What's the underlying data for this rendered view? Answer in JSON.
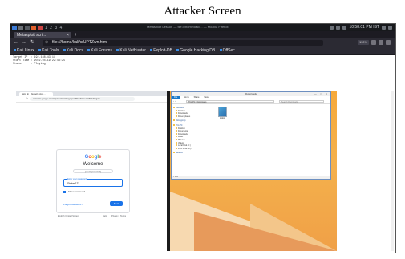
{
  "caption": "Attacker Screen",
  "kali_panel": {
    "workspaces": "1 2 3 4",
    "window_title": "Metasploit Lesson — file:///home/kali/... — Mozilla Firefox",
    "clock": "10:58:01 PM IST"
  },
  "firefox": {
    "tab_title": "Metasploit scri...",
    "tab_close": "×",
    "new_tab": "+",
    "url_scheme": "⊙",
    "url": "file:///home/kali/crUPTZwn.html",
    "zoom": "110%",
    "bookmarks": [
      "Kali Linux",
      "Kali Tools",
      "Kali Docs",
      "Kali Forums",
      "Kali NetHunter",
      "Exploit-DB",
      "Google Hacking DB",
      "OffSec"
    ]
  },
  "page": {
    "meta_text": "Target IP  : 192.168.43.11\nStart Time : 2022-04-19 22:46:25\nStatus     : Playing"
  },
  "chrome": {
    "tab_title": "Sign in - Google Acc...",
    "url": "accounts.google.com/signin/v2/challenge/pwd?flowName=GlifWebSignIn",
    "google_logo": [
      "G",
      "o",
      "o",
      "g",
      "l",
      "e"
    ],
    "title": "Welcome",
    "account": "[email protected]",
    "password_label": "Enter your password",
    "password_value": "Strikes123",
    "show_password": "Show password",
    "forgot": "Forgot password?",
    "next": "Next",
    "footer_lang": "English (United States)",
    "footer_help": "Help",
    "footer_privacy": "Privacy",
    "footer_terms": "Terms"
  },
  "explorer": {
    "title": "Downloads",
    "controls": "— □ ×",
    "ribbon": [
      "File",
      "Home",
      "Share",
      "View"
    ],
    "address": "This PC › Downloads",
    "search_placeholder": "Search Downloads",
    "nav_arrows": "‹ ›",
    "sidebar": [
      {
        "label": "Favorites",
        "group": true
      },
      {
        "label": "Desktop",
        "group": false
      },
      {
        "label": "Downloads",
        "group": false
      },
      {
        "label": "Recent places",
        "group": false
      },
      {
        "label": "Homegroup",
        "group": true
      },
      {
        "label": "This PC",
        "group": true
      },
      {
        "label": "Desktop",
        "group": false
      },
      {
        "label": "Documents",
        "group": false
      },
      {
        "label": "Downloads",
        "group": false
      },
      {
        "label": "Music",
        "group": false
      },
      {
        "label": "Pictures",
        "group": false
      },
      {
        "label": "Videos",
        "group": false
      },
      {
        "label": "Local Disk (C:)",
        "group": false
      },
      {
        "label": "DVD Drive (D:) I",
        "group": false
      },
      {
        "label": "Network",
        "group": true
      }
    ],
    "file_name": "pwdst",
    "status": "1 item"
  }
}
